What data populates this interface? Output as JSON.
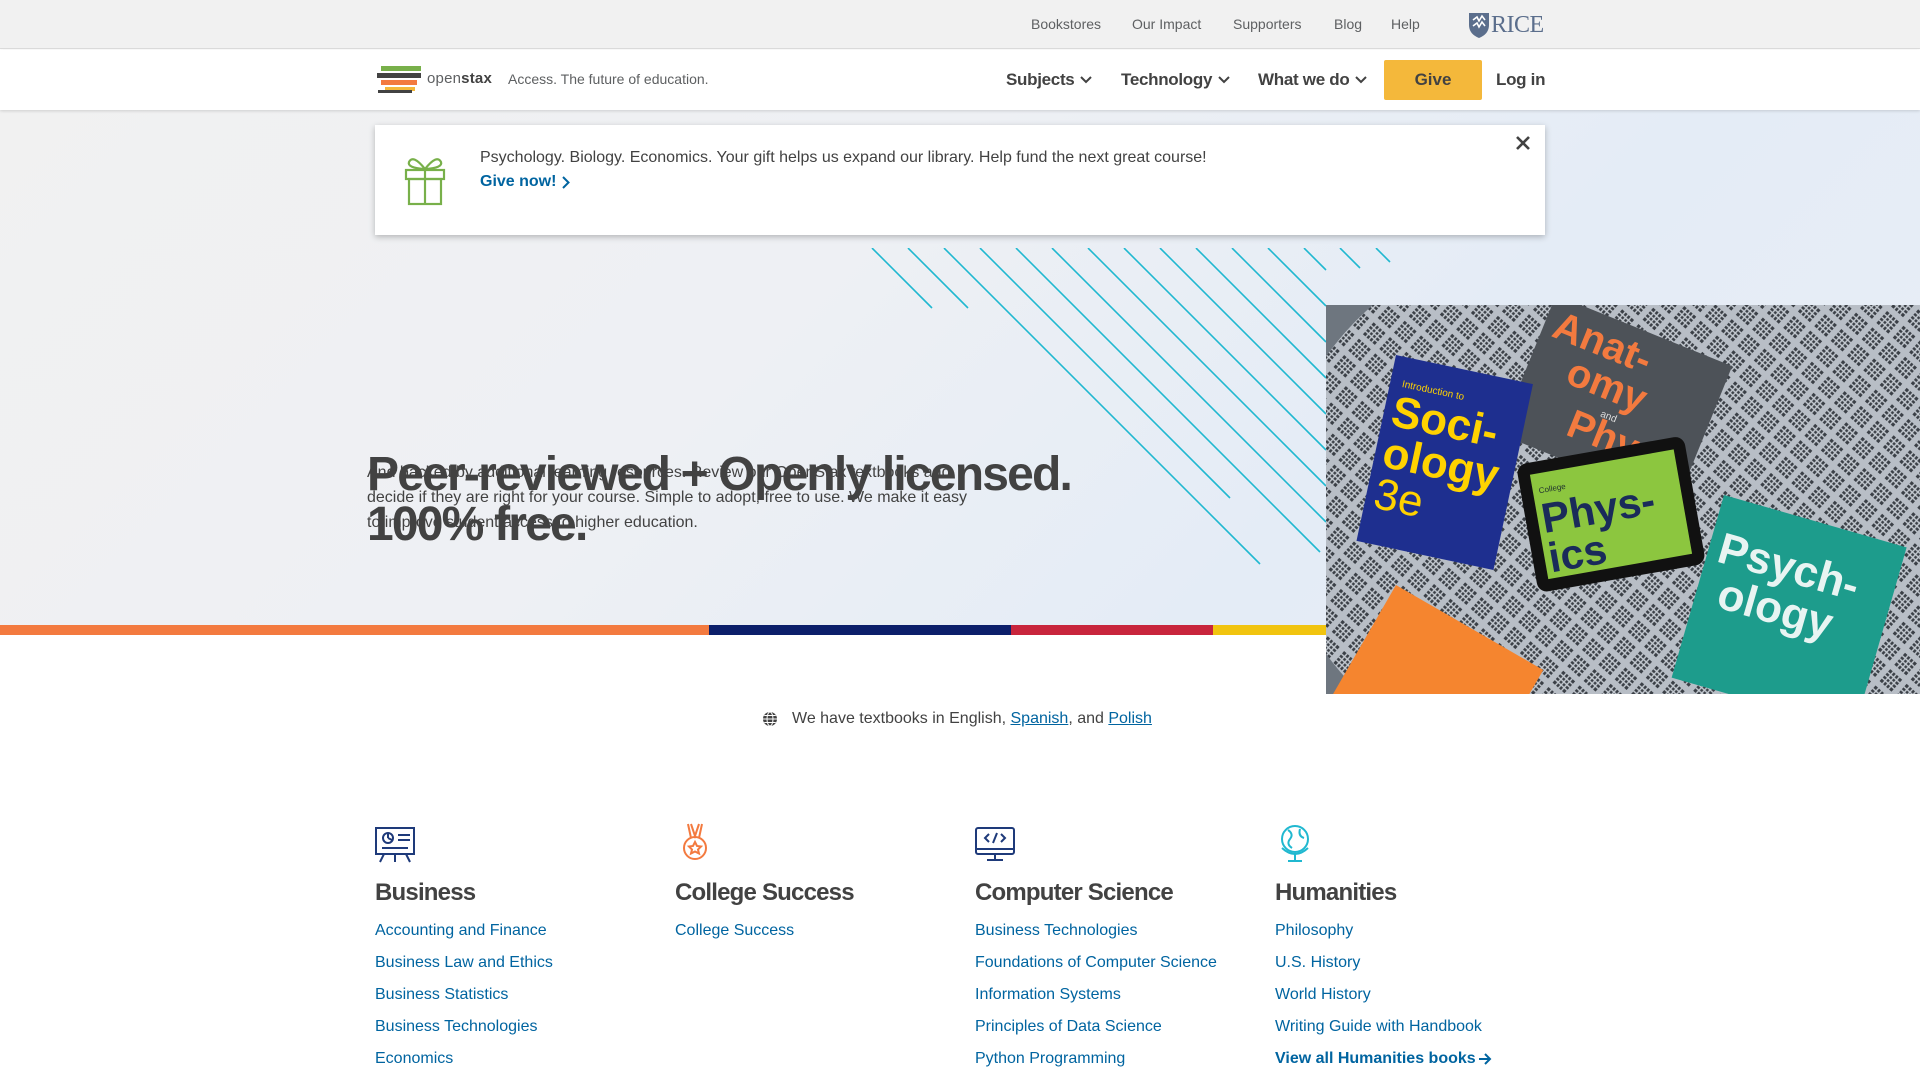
{
  "utility_nav": {
    "links": [
      "Bookstores",
      "Our Impact",
      "Supporters",
      "Blog",
      "Help"
    ],
    "rice_label": "RICE"
  },
  "main_nav": {
    "logo_open": "open",
    "logo_stax": "stax",
    "tagline": "Access. The future of education.",
    "items": [
      "Subjects",
      "Technology",
      "What we do"
    ],
    "give_label": "Give",
    "login_label": "Log in"
  },
  "banner": {
    "text": "Psychology. Biology. Economics. Your gift helps us expand our library. Help fund the next great course!",
    "cta": "Give now!"
  },
  "hero": {
    "title_line1": "Peer-reviewed + Openly licensed.",
    "title_line2": "100% free.",
    "body": "And backed by additional learning resources. Review our OpenStax textbooks and decide if they are right for your course. Simple to adopt, free to use. We make it easy to improve student access to higher education.",
    "bar_colors": [
      "#f37a3f",
      "#0c1f6a",
      "#c8253c",
      "#f1c40f"
    ],
    "photo_books": [
      "Introduction to",
      "Soci-",
      "ology",
      "3e",
      "Anat-",
      "omy",
      "and",
      "Physi-",
      "ology",
      "College",
      "Phys-",
      "ics",
      "Psych-",
      "ology"
    ]
  },
  "languages": {
    "prefix": "We have textbooks in English, ",
    "spanish": "Spanish",
    "middle": ", and ",
    "polish": "Polish"
  },
  "subjects": [
    {
      "icon": "presentation-board-icon",
      "title": "Business",
      "links": [
        "Accounting and Finance",
        "Business Law and Ethics",
        "Business Statistics",
        "Business Technologies",
        "Economics"
      ]
    },
    {
      "icon": "medal-icon",
      "title": "College Success",
      "links": [
        "College Success"
      ]
    },
    {
      "icon": "code-monitor-icon",
      "title": "Computer Science",
      "links": [
        "Business Technologies",
        "Foundations of Computer Science",
        "Information Systems",
        "Principles of Data Science",
        "Python Programming"
      ]
    },
    {
      "icon": "globe-icon",
      "title": "Humanities",
      "links": [
        "Philosophy",
        "U.S. History",
        "World History",
        "Writing Guide with Handbook"
      ],
      "view_all": "View all Humanities books"
    }
  ],
  "colors": {
    "link": "#0064a0",
    "give": "#f4b83b",
    "text": "#424242",
    "stripe": "#20b8d0"
  }
}
